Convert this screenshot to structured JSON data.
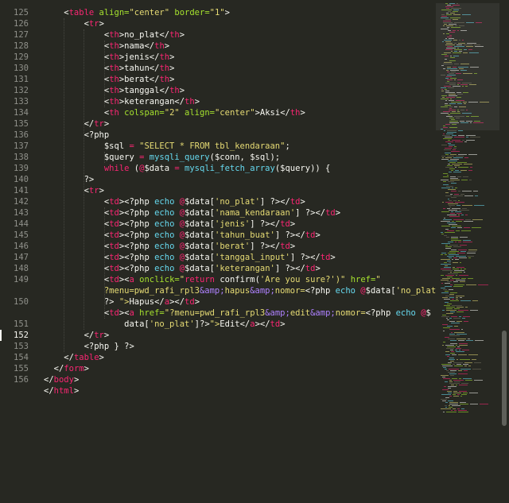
{
  "editor": {
    "gutter_numbers": [
      "125",
      "126",
      "127",
      "128",
      "129",
      "130",
      "131",
      "132",
      "133",
      "134",
      "135",
      "136",
      "137",
      "138",
      "139",
      "140",
      "141",
      "142",
      "143",
      "144",
      "145",
      "146",
      "147",
      "148",
      "149",
      "",
      "150",
      "",
      "151",
      "152",
      "153",
      "154",
      "155",
      "156"
    ],
    "current_line_number": "152",
    "lines": [
      [
        [
          "    <",
          "tag0"
        ],
        [
          "table",
          "tag"
        ],
        [
          " align=",
          "attr"
        ],
        [
          "\"center\"",
          "str"
        ],
        [
          " border=",
          "attr"
        ],
        [
          "\"1\"",
          "str"
        ],
        [
          ">",
          "pun"
        ]
      ],
      [
        [
          "        <",
          "pun"
        ],
        [
          "tr",
          "tag"
        ],
        [
          ">",
          "pun"
        ]
      ],
      [
        [
          "            <",
          "pun"
        ],
        [
          "th",
          "tag"
        ],
        [
          ">",
          "pun"
        ],
        [
          "no_plat",
          "txt"
        ],
        [
          "</",
          "pun"
        ],
        [
          "th",
          "tag"
        ],
        [
          ">",
          "pun"
        ]
      ],
      [
        [
          "            <",
          "pun"
        ],
        [
          "th",
          "tag"
        ],
        [
          ">",
          "pun"
        ],
        [
          "nama",
          "txt"
        ],
        [
          "</",
          "pun"
        ],
        [
          "th",
          "tag"
        ],
        [
          ">",
          "pun"
        ]
      ],
      [
        [
          "            <",
          "pun"
        ],
        [
          "th",
          "tag"
        ],
        [
          ">",
          "pun"
        ],
        [
          "jenis",
          "txt"
        ],
        [
          "</",
          "pun"
        ],
        [
          "th",
          "tag"
        ],
        [
          ">",
          "pun"
        ]
      ],
      [
        [
          "            <",
          "pun"
        ],
        [
          "th",
          "tag"
        ],
        [
          ">",
          "pun"
        ],
        [
          "tahun",
          "txt"
        ],
        [
          "</",
          "pun"
        ],
        [
          "th",
          "tag"
        ],
        [
          ">",
          "pun"
        ]
      ],
      [
        [
          "            <",
          "pun"
        ],
        [
          "th",
          "tag"
        ],
        [
          ">",
          "pun"
        ],
        [
          "berat",
          "txt"
        ],
        [
          "</",
          "pun"
        ],
        [
          "th",
          "tag"
        ],
        [
          ">",
          "pun"
        ]
      ],
      [
        [
          "            <",
          "pun"
        ],
        [
          "th",
          "tag"
        ],
        [
          ">",
          "pun"
        ],
        [
          "tanggal",
          "txt"
        ],
        [
          "</",
          "pun"
        ],
        [
          "th",
          "tag"
        ],
        [
          ">",
          "pun"
        ]
      ],
      [
        [
          "            <",
          "pun"
        ],
        [
          "th",
          "tag"
        ],
        [
          ">",
          "pun"
        ],
        [
          "keterangan",
          "txt"
        ],
        [
          "</",
          "pun"
        ],
        [
          "th",
          "tag"
        ],
        [
          ">",
          "pun"
        ]
      ],
      [
        [
          "            <",
          "pun"
        ],
        [
          "th",
          "tag"
        ],
        [
          " colspan=",
          "attr"
        ],
        [
          "\"2\"",
          "str"
        ],
        [
          " align=",
          "attr"
        ],
        [
          "\"center\"",
          "str"
        ],
        [
          ">",
          "pun"
        ],
        [
          "Aksi",
          "txt"
        ],
        [
          "</",
          "pun"
        ],
        [
          "th",
          "tag"
        ],
        [
          ">",
          "pun"
        ]
      ],
      [
        [
          "        </",
          "pun"
        ],
        [
          "tr",
          "tag"
        ],
        [
          ">",
          "pun"
        ]
      ],
      [
        [
          "        <?php",
          "pun"
        ]
      ],
      [
        [
          "            $sql",
          "var"
        ],
        [
          " = ",
          "kw"
        ],
        [
          "\"SELECT * FROM tbl_kendaraan\"",
          "str"
        ],
        [
          ";",
          "pun"
        ]
      ],
      [
        [
          "            $query",
          "var"
        ],
        [
          " = ",
          "kw"
        ],
        [
          "mysqli_query",
          "fn"
        ],
        [
          "($conn, $sql);",
          "var"
        ]
      ],
      [
        [
          "            while",
          "kw"
        ],
        [
          " (",
          "pun"
        ],
        [
          "@",
          "kw"
        ],
        [
          "$data",
          "var"
        ],
        [
          " = ",
          "kw"
        ],
        [
          "mysqli_fetch_array",
          "fn"
        ],
        [
          "($query)) {",
          "var"
        ]
      ],
      [
        [
          "        ?>",
          "pun"
        ]
      ],
      [
        [
          "        <",
          "pun"
        ],
        [
          "tr",
          "tag"
        ],
        [
          ">",
          "pun"
        ]
      ],
      [
        [
          "            <",
          "pun"
        ],
        [
          "td",
          "tag"
        ],
        [
          "><?php ",
          "pun"
        ],
        [
          "echo",
          "phpkw"
        ],
        [
          " @",
          "kw"
        ],
        [
          "$data[",
          "var"
        ],
        [
          "'no_plat'",
          "str"
        ],
        [
          "] ?></",
          "pun"
        ],
        [
          "td",
          "tag"
        ],
        [
          ">",
          "pun"
        ]
      ],
      [
        [
          "            <",
          "pun"
        ],
        [
          "td",
          "tag"
        ],
        [
          "><?php ",
          "pun"
        ],
        [
          "echo",
          "phpkw"
        ],
        [
          " @",
          "kw"
        ],
        [
          "$data[",
          "var"
        ],
        [
          "'nama_kendaraan'",
          "str"
        ],
        [
          "] ?></",
          "pun"
        ],
        [
          "td",
          "tag"
        ],
        [
          ">",
          "pun"
        ]
      ],
      [
        [
          "            <",
          "pun"
        ],
        [
          "td",
          "tag"
        ],
        [
          "><?php ",
          "pun"
        ],
        [
          "echo",
          "phpkw"
        ],
        [
          " @",
          "kw"
        ],
        [
          "$data[",
          "var"
        ],
        [
          "'jenis'",
          "str"
        ],
        [
          "] ?></",
          "pun"
        ],
        [
          "td",
          "tag"
        ],
        [
          ">",
          "pun"
        ]
      ],
      [
        [
          "            <",
          "pun"
        ],
        [
          "td",
          "tag"
        ],
        [
          "><?php ",
          "pun"
        ],
        [
          "echo",
          "phpkw"
        ],
        [
          " @",
          "kw"
        ],
        [
          "$data[",
          "var"
        ],
        [
          "'tahun_buat'",
          "str"
        ],
        [
          "] ?></",
          "pun"
        ],
        [
          "td",
          "tag"
        ],
        [
          ">",
          "pun"
        ]
      ],
      [
        [
          "            <",
          "pun"
        ],
        [
          "td",
          "tag"
        ],
        [
          "><?php ",
          "pun"
        ],
        [
          "echo",
          "phpkw"
        ],
        [
          " @",
          "kw"
        ],
        [
          "$data[",
          "var"
        ],
        [
          "'berat'",
          "str"
        ],
        [
          "] ?></",
          "pun"
        ],
        [
          "td",
          "tag"
        ],
        [
          ">",
          "pun"
        ]
      ],
      [
        [
          "            <",
          "pun"
        ],
        [
          "td",
          "tag"
        ],
        [
          "><?php ",
          "pun"
        ],
        [
          "echo",
          "phpkw"
        ],
        [
          " @",
          "kw"
        ],
        [
          "$data[",
          "var"
        ],
        [
          "'tanggal_input'",
          "str"
        ],
        [
          "] ?></",
          "pun"
        ],
        [
          "td",
          "tag"
        ],
        [
          ">",
          "pun"
        ]
      ],
      [
        [
          "            <",
          "pun"
        ],
        [
          "td",
          "tag"
        ],
        [
          "><?php ",
          "pun"
        ],
        [
          "echo",
          "phpkw"
        ],
        [
          " @",
          "kw"
        ],
        [
          "$data[",
          "var"
        ],
        [
          "'keterangan'",
          "str"
        ],
        [
          "] ?></",
          "pun"
        ],
        [
          "td",
          "tag"
        ],
        [
          ">",
          "pun"
        ]
      ],
      [
        [
          "            <",
          "pun"
        ],
        [
          "td",
          "tag"
        ],
        [
          "><",
          "pun"
        ],
        [
          "a",
          "tag"
        ],
        [
          " onclick=",
          "attr"
        ],
        [
          "\"",
          "str"
        ],
        [
          "return",
          "kw"
        ],
        [
          " confirm(",
          "pun"
        ],
        [
          "'Are you sure?'",
          "str"
        ],
        [
          ")\"",
          "str"
        ],
        [
          " href=",
          "attr"
        ],
        [
          "\"",
          "str"
        ]
      ],
      [
        [
          "            ?menu=pwd_rafi_rpl3",
          "str"
        ],
        [
          "&amp;",
          "ent"
        ],
        [
          "hapus",
          "str"
        ],
        [
          "&amp;",
          "ent"
        ],
        [
          "nomor=",
          "str"
        ],
        [
          "<?php ",
          "pun"
        ],
        [
          "echo",
          "phpkw"
        ],
        [
          " @",
          "kw"
        ],
        [
          "$data[",
          "var"
        ],
        [
          "'no_plat'",
          "str"
        ],
        [
          "]",
          "var"
        ]
      ],
      [
        [
          "            ?>",
          "pun"
        ],
        [
          " \">",
          "str"
        ],
        [
          "Hapus",
          "txt"
        ],
        [
          "</",
          "pun"
        ],
        [
          "a",
          "tag"
        ],
        [
          "></",
          "pun"
        ],
        [
          "td",
          "tag"
        ],
        [
          ">",
          "pun"
        ]
      ],
      [
        [
          "            <",
          "pun"
        ],
        [
          "td",
          "tag"
        ],
        [
          "><",
          "pun"
        ],
        [
          "a",
          "tag"
        ],
        [
          " href=",
          "attr"
        ],
        [
          "\"?menu=pwd_rafi_rpl3",
          "str"
        ],
        [
          "&amp;",
          "ent"
        ],
        [
          "edit",
          "str"
        ],
        [
          "&amp;",
          "ent"
        ],
        [
          "nomor=",
          "str"
        ],
        [
          "<?php ",
          "pun"
        ],
        [
          "echo",
          "phpkw"
        ],
        [
          " @",
          "kw"
        ],
        [
          "$",
          "var"
        ]
      ],
      [
        [
          "                data[",
          "var"
        ],
        [
          "'no_plat'",
          "str"
        ],
        [
          "]?>",
          "pun"
        ],
        [
          "\">",
          "str"
        ],
        [
          "Edit",
          "txt"
        ],
        [
          "</",
          "pun"
        ],
        [
          "a",
          "tag"
        ],
        [
          "></",
          "pun"
        ],
        [
          "td",
          "tag"
        ],
        [
          ">",
          "pun"
        ]
      ],
      [
        [
          "        </",
          "pun"
        ],
        [
          "tr",
          "tag"
        ],
        [
          ">",
          "pun"
        ]
      ],
      [
        [
          "        <?php } ?>",
          "pun"
        ]
      ],
      [
        [
          "    </",
          "pun"
        ],
        [
          "table",
          "tag"
        ],
        [
          ">",
          "pun"
        ]
      ],
      [
        [
          "  </",
          "pun"
        ],
        [
          "form",
          "tag"
        ],
        [
          ">",
          "pun"
        ]
      ],
      [
        [
          "</",
          "pun"
        ],
        [
          "body",
          "tag"
        ],
        [
          ">",
          "pun"
        ]
      ],
      [
        [
          "</",
          "pun"
        ],
        [
          "html",
          "tag"
        ],
        [
          ">",
          "pun"
        ]
      ]
    ]
  },
  "colors": {
    "background": "#272822",
    "tag": "#f92672",
    "attribute": "#a6e22e",
    "string": "#e6db74",
    "function": "#66d9ef",
    "entity": "#ae81ff",
    "text": "#f8f8f2",
    "gutter": "#8f908a"
  }
}
